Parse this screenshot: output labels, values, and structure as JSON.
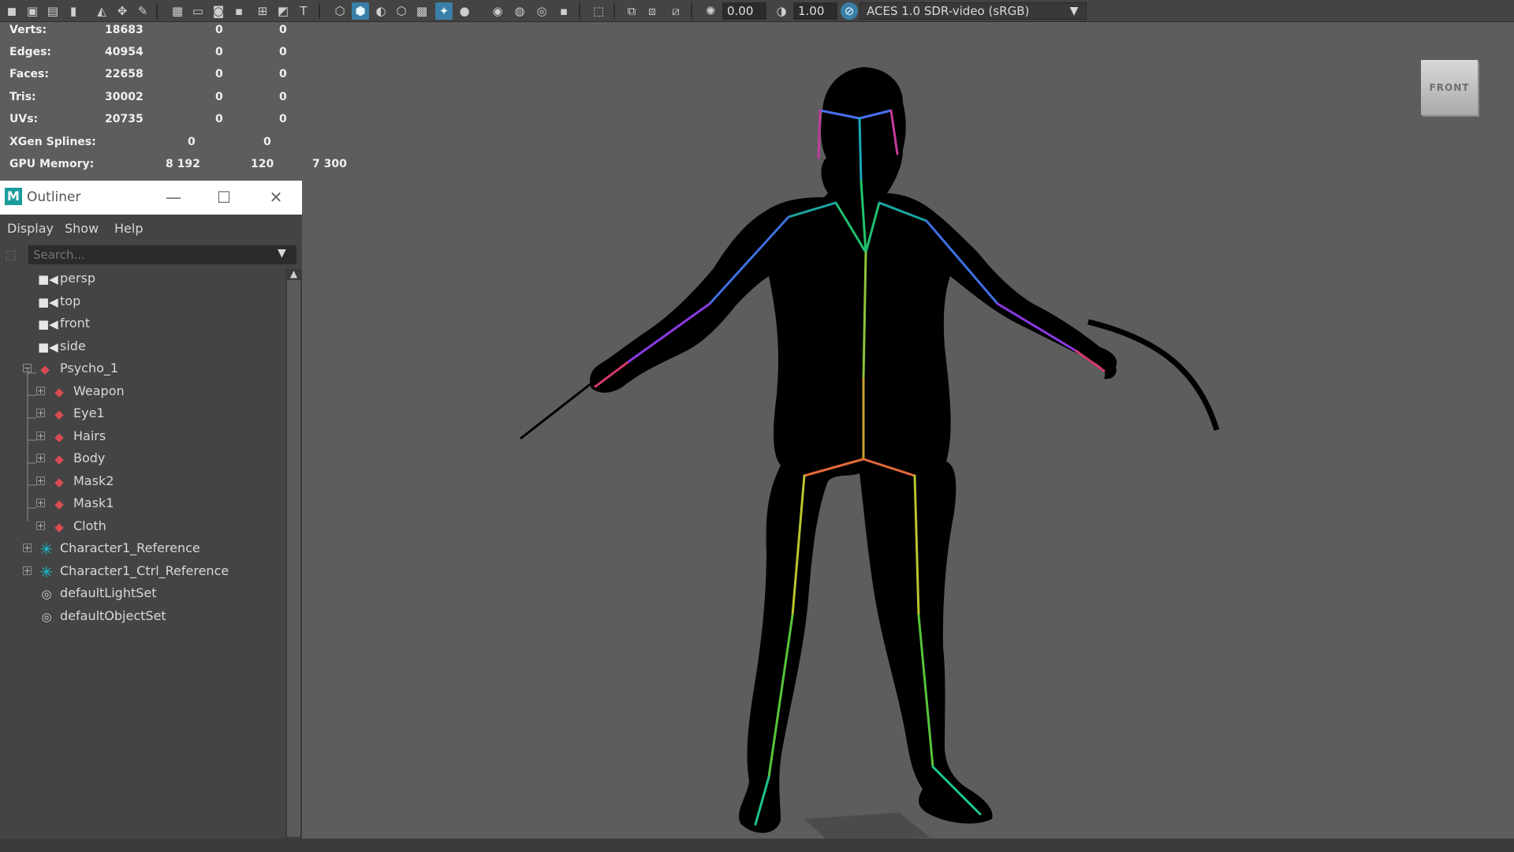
{
  "toolbar": {
    "icons": [
      "camera-select-icon",
      "camera-attributes-icon",
      "bookmark-icon",
      "image-plane-icon",
      "grease-pencil-icon",
      "grid-icon",
      "film-gate-icon",
      "resolution-gate-icon",
      "safe-action-icon",
      "field-chart-icon",
      "isolate-select-icon",
      "xray-icon",
      "wireframe-icon",
      "smooth-shade-icon",
      "use-default-material-icon",
      "wireframe-on-shaded-icon",
      "textured-icon",
      "use-all-lights-icon",
      "shadows-icon",
      "screen-space-ao-icon",
      "motion-blur-icon",
      "multisample-aa-icon",
      "depth-of-field-icon",
      "isolate-icon",
      "xray-joints-icon",
      "xray-active-icon",
      "backface-culling-icon",
      "exposure-icon",
      "gamma-icon",
      "color-management-icon"
    ],
    "exposure_value": "0.00",
    "gamma_value": "1.00",
    "color_space": "ACES 1.0 SDR-video (sRGB)"
  },
  "hud": {
    "rows": [
      {
        "label": "Verts:",
        "v1": "18683",
        "v2": "0",
        "v3": "0"
      },
      {
        "label": "Edges:",
        "v1": "40954",
        "v2": "0",
        "v3": "0"
      },
      {
        "label": "Faces:",
        "v1": "22658",
        "v2": "0",
        "v3": "0"
      },
      {
        "label": "Tris:",
        "v1": "30002",
        "v2": "0",
        "v3": "0"
      },
      {
        "label": "UVs:",
        "v1": "20735",
        "v2": "0",
        "v3": "0"
      },
      {
        "label": "XGen Splines:",
        "v1": "0",
        "v2": "0",
        "v3": ""
      },
      {
        "label": "GPU Memory:",
        "v1": "8 192",
        "v2": "120",
        "v3": "7 300"
      }
    ]
  },
  "viewcube": {
    "label": "FRONT"
  },
  "outliner": {
    "logo": "M",
    "title": "Outliner",
    "window_buttons": {
      "minimize": "—",
      "maximize": "☐",
      "close": "✕"
    },
    "menus": [
      "Display",
      "Show",
      "Help"
    ],
    "search_placeholder": "Search...",
    "nodes": [
      {
        "label": "persp",
        "icon": "camera-icon",
        "expander": ""
      },
      {
        "label": "top",
        "icon": "camera-icon",
        "expander": ""
      },
      {
        "label": "front",
        "icon": "camera-icon",
        "expander": ""
      },
      {
        "label": "side",
        "icon": "camera-icon",
        "expander": ""
      },
      {
        "label": "Psycho_1",
        "icon": "mesh-group-icon",
        "expander": "−"
      },
      {
        "label": "Weapon",
        "icon": "mesh-group-icon",
        "expander": "+"
      },
      {
        "label": "Eye1",
        "icon": "mesh-group-icon",
        "expander": "+"
      },
      {
        "label": "Hairs",
        "icon": "mesh-group-icon",
        "expander": "+"
      },
      {
        "label": "Body",
        "icon": "mesh-group-icon",
        "expander": "+"
      },
      {
        "label": "Mask2",
        "icon": "mesh-group-icon",
        "expander": "+"
      },
      {
        "label": "Mask1",
        "icon": "mesh-group-icon",
        "expander": "+"
      },
      {
        "label": "Cloth",
        "icon": "mesh-group-icon",
        "expander": "+"
      },
      {
        "label": "Character1_Reference",
        "icon": "reference-joint-icon",
        "expander": "+"
      },
      {
        "label": "Character1_Ctrl_Reference",
        "icon": "reference-joint-icon",
        "expander": "+"
      },
      {
        "label": "defaultLightSet",
        "icon": "set-icon",
        "expander": ""
      },
      {
        "label": "defaultObjectSet",
        "icon": "set-icon",
        "expander": ""
      }
    ]
  },
  "colors": {
    "accent": "#3a7fa7",
    "viewport_bg": "#5d5d5d",
    "panel_bg": "#444444",
    "mesh_icon": "#d94b52",
    "reference_icon": "#16bfd0"
  }
}
